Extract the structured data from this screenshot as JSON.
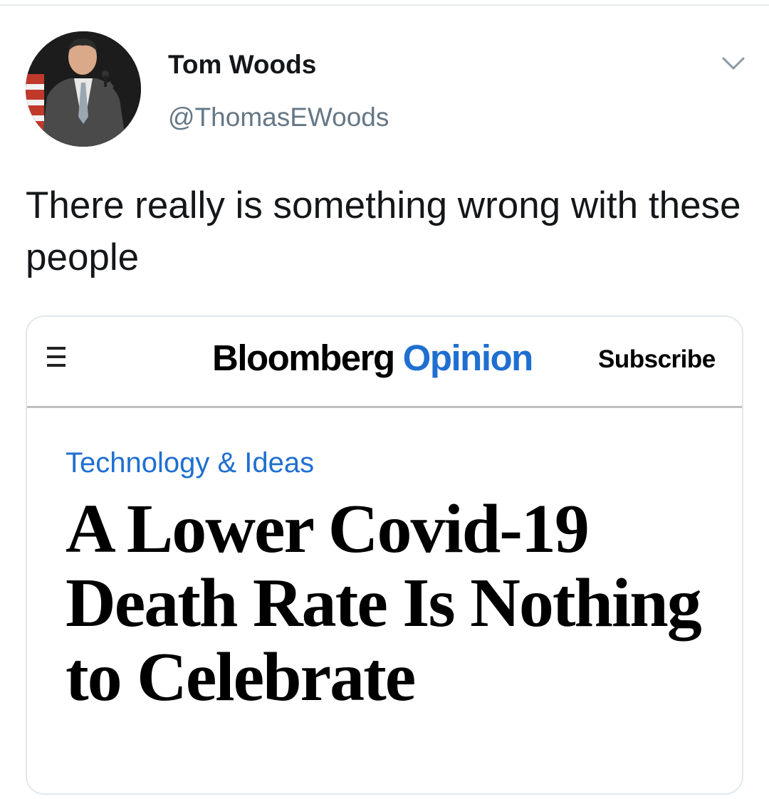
{
  "tweet": {
    "author": {
      "name": "Tom Woods",
      "handle": "@ThomasEWoods"
    },
    "menu_icon": "chevron-down-icon",
    "text": "There really is something wrong with these people"
  },
  "card": {
    "menu_icon": "hamburger-menu-icon",
    "brand": "Bloomberg",
    "section": "Opinion",
    "subscribe_label": "Subscribe",
    "category": "Technology & Ideas",
    "headline": "A Lower Covid-19 Death Rate Is Nothing to Celebrate",
    "colors": {
      "accent": "#1f6fd1",
      "text": "#000000"
    }
  }
}
